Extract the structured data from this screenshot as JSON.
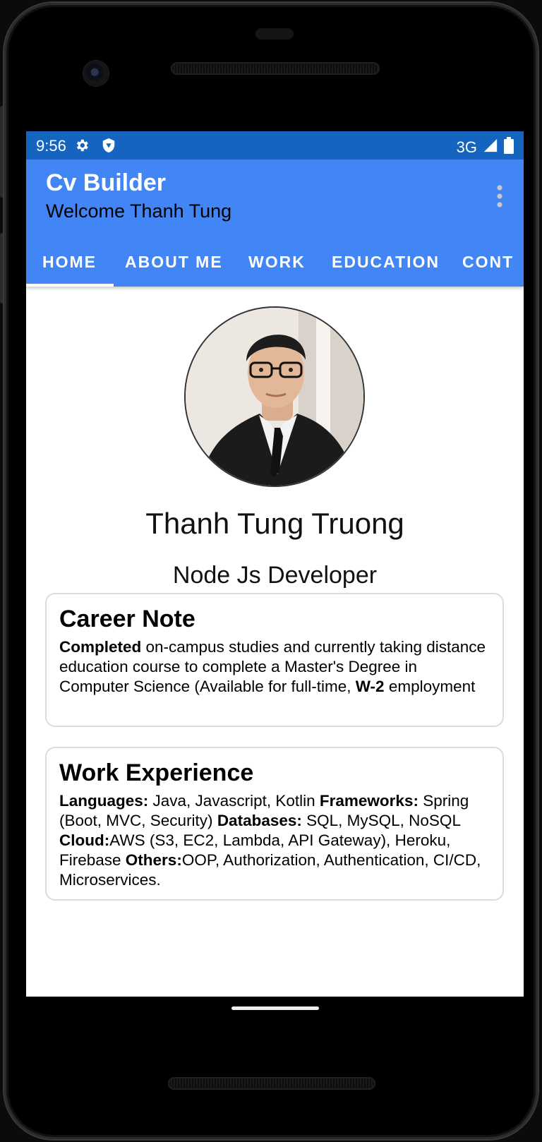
{
  "status_bar": {
    "time": "9:56",
    "network": "3G"
  },
  "app_bar": {
    "title": "Cv Builder",
    "subtitle": "Welcome Thanh Tung"
  },
  "tabs": [
    {
      "label": "HOME"
    },
    {
      "label": "ABOUT ME"
    },
    {
      "label": "WORK"
    },
    {
      "label": "EDUCATION"
    },
    {
      "label": "CONT"
    }
  ],
  "profile": {
    "name": "Thanh Tung Truong",
    "role": "Node Js Developer"
  },
  "career_note": {
    "heading": "Career Note",
    "lead_bold": "Completed",
    "text1": " on-campus studies and currently taking distance education course to complete a Master's Degree in Computer Science (Available for full-time, ",
    "bold2": "W-2",
    "text2": " employment"
  },
  "work_experience": {
    "heading": "Work Experience",
    "languages_label": "Languages:",
    "languages": " Java, Javascript, Kotlin ",
    "frameworks_label": "Frameworks:",
    "frameworks": " Spring (Boot, MVC, Security) ",
    "databases_label": "Databases:",
    "databases": " SQL, MySQL, NoSQL ",
    "cloud_label": "Cloud:",
    "cloud": "AWS (S3, EC2, Lambda, API Gateway), Heroku, Firebase ",
    "others_label": "Others:",
    "others": "OOP, Authorization, Authentication, CI/CD, Microservices."
  },
  "colors": {
    "status_bar": "#1565c0",
    "app_bar": "#4285f4"
  },
  "icons": {
    "settings": "gear-icon",
    "vpn": "shield-icon",
    "signal": "cell-signal-icon",
    "battery": "battery-icon",
    "overflow": "more-vert-icon"
  }
}
